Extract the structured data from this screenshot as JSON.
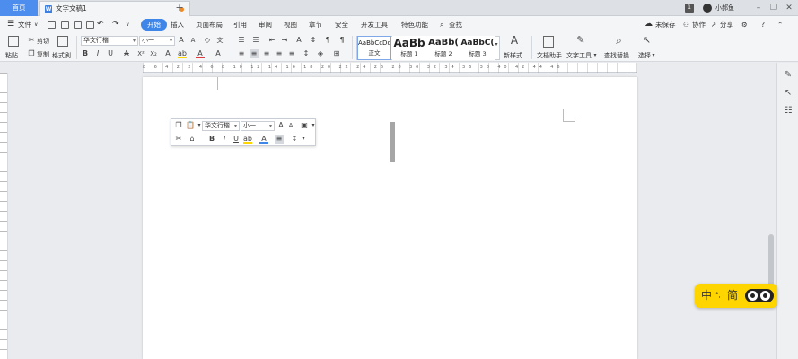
{
  "titlebar": {
    "home_tab": "首页",
    "doc_tab": "文字文稿1",
    "doc_icon": "W",
    "new_tab": "+",
    "page_count": "1",
    "user_name": "小郝鱼"
  },
  "menubar": {
    "file": "文件",
    "items": [
      "开始",
      "插入",
      "页面布局",
      "引用",
      "审阅",
      "视图",
      "章节",
      "安全",
      "开发工具",
      "特色功能",
      "查找"
    ],
    "right": [
      "未保存",
      "协作",
      "分享"
    ]
  },
  "ribbon": {
    "paste": "粘贴",
    "cut": "剪切",
    "copy": "复制",
    "format_painter": "格式刷",
    "font_name": "华文行楷",
    "font_size": "小一",
    "styles": [
      {
        "sample": "AaBbCcDd",
        "label": "正文"
      },
      {
        "sample": "AaBb",
        "label": "标题 1"
      },
      {
        "sample": "AaBb(",
        "label": "标题 2"
      },
      {
        "sample": "AaBbC(",
        "label": "标题 3"
      }
    ],
    "new_style": "新样式",
    "doc_assistant": "文档助手",
    "text_tools": "文字工具",
    "find_replace": "查找替换",
    "select": "选择"
  },
  "ruler": {
    "numbers": "8 6 4 2 2 4 6 8 10 12 14 16 18 20 22 24 26 28 30 32 34 36 38 40 42 44 46"
  },
  "mini_toolbar": {
    "font_name": "华文行楷",
    "font_size": "小一"
  },
  "ime": {
    "lang": "中",
    "punct": "°,",
    "mode": "简"
  }
}
